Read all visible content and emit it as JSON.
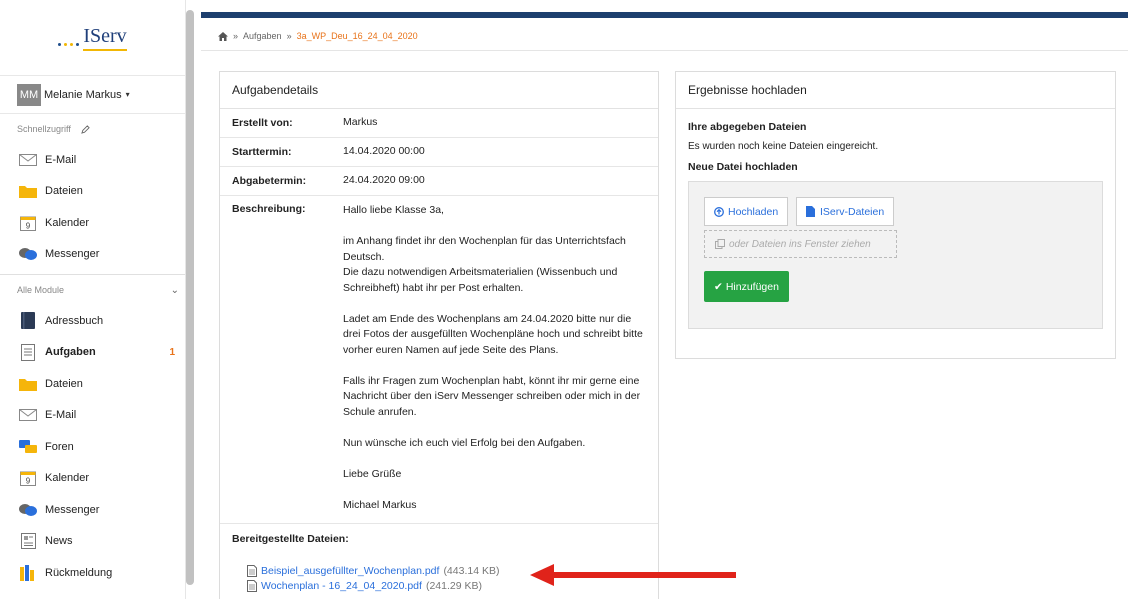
{
  "sidebar": {
    "logo_text": "IServ",
    "user": {
      "initials": "MM",
      "name": "Melanie Markus"
    },
    "quick_access_label": "Schnellzugriff",
    "quick_items": [
      {
        "label": "E-Mail",
        "icon": "envelope-icon"
      },
      {
        "label": "Dateien",
        "icon": "folder-icon"
      },
      {
        "label": "Kalender",
        "icon": "calendar-icon"
      },
      {
        "label": "Messenger",
        "icon": "chat-bubbles-icon"
      }
    ],
    "all_modules_label": "Alle Module",
    "modules": [
      {
        "label": "Adressbuch",
        "icon": "addressbook-icon"
      },
      {
        "label": "Aufgaben",
        "icon": "tasks-icon",
        "badge": "1",
        "active": true
      },
      {
        "label": "Dateien",
        "icon": "folder-icon"
      },
      {
        "label": "E-Mail",
        "icon": "envelope-icon"
      },
      {
        "label": "Foren",
        "icon": "forum-icon"
      },
      {
        "label": "Kalender",
        "icon": "calendar-icon"
      },
      {
        "label": "Messenger",
        "icon": "chat-bubbles-icon"
      },
      {
        "label": "News",
        "icon": "news-icon"
      },
      {
        "label": "Rückmeldung",
        "icon": "feedback-icon"
      }
    ]
  },
  "breadcrumb": {
    "parent": "Aufgaben",
    "current": "3a_WP_Deu_16_24_04_2020"
  },
  "details": {
    "title": "Aufgabendetails",
    "created_by_label": "Erstellt von:",
    "created_by": "Markus",
    "start_label": "Starttermin:",
    "start": "14.04.2020 00:00",
    "due_label": "Abgabetermin:",
    "due": "24.04.2020 09:00",
    "desc_label": "Beschreibung:",
    "desc": {
      "p1": "Hallo liebe Klasse 3a,",
      "p2": "im Anhang findet ihr den Wochenplan für das Unterrichtsfach Deutsch.\nDie dazu notwendigen Arbeitsmaterialien (Wissenbuch und Schreibheft) habt ihr per Post erhalten.",
      "p3": "Ladet am Ende des Wochenplans am 24.04.2020 bitte nur die drei Fotos der ausgefüllten Wochenpläne hoch und schreibt bitte vorher euren Namen auf jede Seite des Plans.",
      "p4": "Falls ihr Fragen zum Wochenplan habt, könnt ihr mir gerne eine Nachricht über den iServ Messenger schreiben oder mich in der Schule anrufen.",
      "p5": "Nun wünsche ich euch viel Erfolg bei den Aufgaben.",
      "p6": "Liebe Grüße",
      "p7": "Michael Markus"
    },
    "files_label": "Bereitgestellte Dateien:",
    "files": [
      {
        "name": "Beispiel_ausgefüllter_Wochenplan.pdf",
        "size": "(443.14 KB)"
      },
      {
        "name": "Wochenplan - 16_24_04_2020.pdf",
        "size": "(241.29 KB)"
      }
    ]
  },
  "upload": {
    "title": "Ergebnisse hochladen",
    "my_files_heading": "Ihre abgegeben Dateien",
    "no_files_text": "Es wurden noch keine Dateien eingereicht.",
    "new_file_heading": "Neue Datei hochladen",
    "upload_button": "Hochladen",
    "iserv_files_button": "IServ-Dateien",
    "dropzone_text": "oder Dateien ins Fenster ziehen",
    "add_button": "Hinzufügen"
  },
  "colors": {
    "accent": "#e8731a",
    "link": "#2a6fdb",
    "topbar": "#1d3f6e",
    "success": "#26a343",
    "arrow": "#e0231a"
  }
}
